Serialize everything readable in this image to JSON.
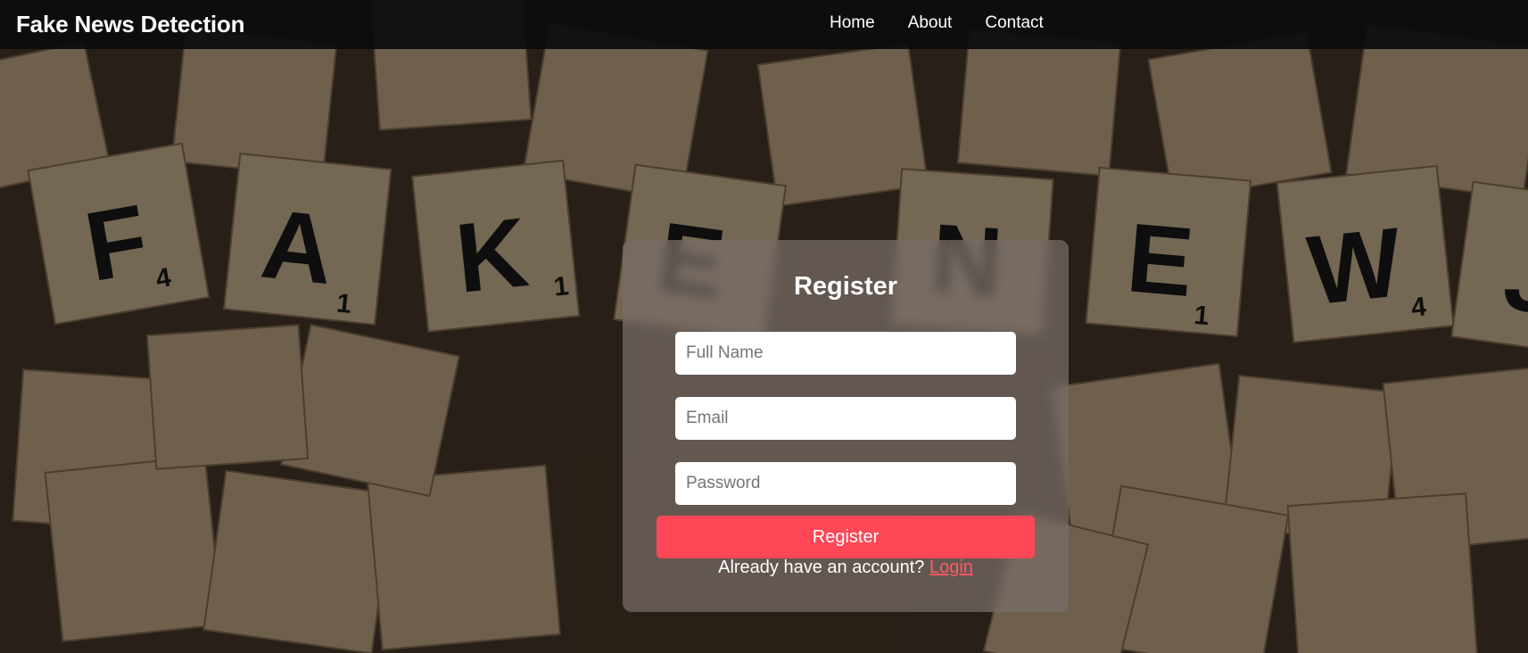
{
  "navbar": {
    "brand": "Fake News Detection",
    "links": [
      "Home",
      "About",
      "Contact"
    ]
  },
  "register": {
    "title": "Register",
    "full_name_placeholder": "Full Name",
    "email_placeholder": "Email",
    "password_placeholder": "Password",
    "button_label": "Register",
    "login_prompt": "Already have an account?",
    "login_link": "Login"
  },
  "background": {
    "tile_letters": [
      "F",
      "A",
      "K",
      "E",
      "N",
      "E",
      "W",
      "S"
    ],
    "tile_subscripts": [
      "4",
      "1",
      "1",
      "1",
      "4"
    ]
  },
  "colors": {
    "accent": "#ff4757",
    "navbar": "#0c0c0c",
    "card": "#786e68",
    "tile": "#c9b08c"
  }
}
